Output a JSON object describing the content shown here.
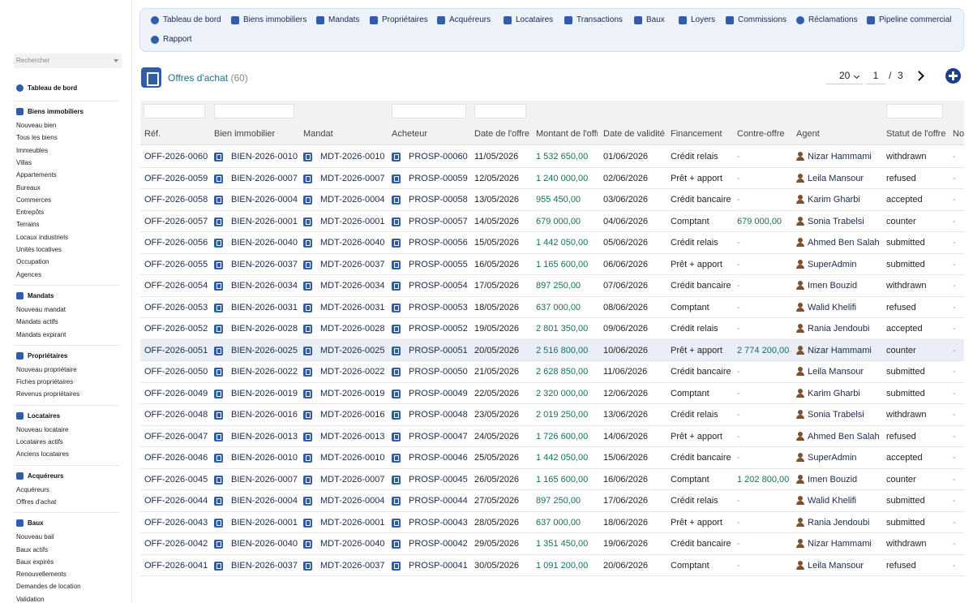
{
  "sidebar": {
    "search_placeholder": "Rechercher",
    "dashboard": "Tableau de bord",
    "sections": [
      {
        "title": "Biens immobiliers",
        "items": [
          "Nouveau bien",
          "Tous les biens",
          "Immeubles",
          "Villas",
          "Appartements",
          "Bureaux",
          "Commerces",
          "Entrepôts",
          "Terrains",
          "Locaux industriels",
          "Unités locatives",
          "Occupation",
          "Agences"
        ]
      },
      {
        "title": "Mandats",
        "items": [
          "Nouveau mandat",
          "Mandats actifs",
          "Mandats expirant"
        ]
      },
      {
        "title": "Propriétaires",
        "items": [
          "Nouveau propriétaire",
          "Fiches propriétaires",
          "Revenus propriétaires"
        ]
      },
      {
        "title": "Locataires",
        "items": [
          "Nouveau locataire",
          "Locataires actifs",
          "Anciens locataires"
        ]
      },
      {
        "title": "Acquéreurs",
        "items": [
          "Acquéreurs",
          "Offres d'achat"
        ]
      },
      {
        "title": "Baux",
        "items": [
          "Nouveau bail",
          "Baux actifs",
          "Baux expirés",
          "Renouvellements",
          "Demandes de location",
          "Validation"
        ]
      }
    ]
  },
  "topnav": [
    "Tableau de bord",
    "Biens immobiliers",
    "Mandats",
    "Propriétaires",
    "Acquéreurs",
    "Locataires",
    "Transactions",
    "Baux",
    "Loyers",
    "Commissions",
    "Réclamations",
    "Pipeline commercial",
    "Rapport"
  ],
  "page": {
    "title": "Offres d'achat",
    "count": "(60)"
  },
  "pager": {
    "page_size": "20",
    "page": "1",
    "slash": "/",
    "total": "3"
  },
  "columns": [
    "Réf.",
    "Bien immobilier",
    "Mandat",
    "Acheteur",
    "Date de l'offre",
    "Montant de l'offre",
    "Date de validité",
    "Financement",
    "Contre-offre",
    "Agent",
    "Statut de l'offre",
    "Notes"
  ],
  "rows": [
    [
      "OFF-2026-0060",
      "BIEN-2026-0010",
      "MDT-2026-0010",
      "PROSP-00060",
      "11/05/2026",
      "1 532 650,00",
      "01/06/2026",
      "Crédit relais",
      "-",
      "Nizar Hammami",
      "withdrawn",
      "-"
    ],
    [
      "OFF-2026-0059",
      "BIEN-2026-0007",
      "MDT-2026-0007",
      "PROSP-00059",
      "12/05/2026",
      "1 240 000,00",
      "02/06/2026",
      "Prêt + apport",
      "-",
      "Leila Mansour",
      "refused",
      "-"
    ],
    [
      "OFF-2026-0058",
      "BIEN-2026-0004",
      "MDT-2026-0004",
      "PROSP-00058",
      "13/05/2026",
      "955 450,00",
      "03/06/2026",
      "Crédit bancaire",
      "-",
      "Karim Gharbi",
      "accepted",
      "-"
    ],
    [
      "OFF-2026-0057",
      "BIEN-2026-0001",
      "MDT-2026-0001",
      "PROSP-00057",
      "14/05/2026",
      "679 000,00",
      "04/06/2026",
      "Comptant",
      "679 000,00",
      "Sonia Trabelsi",
      "counter",
      "-"
    ],
    [
      "OFF-2026-0056",
      "BIEN-2026-0040",
      "MDT-2026-0040",
      "PROSP-00056",
      "15/05/2026",
      "1 442 050,00",
      "05/06/2026",
      "Crédit relais",
      "-",
      "Ahmed Ben Salah",
      "submitted",
      "-"
    ],
    [
      "OFF-2026-0055",
      "BIEN-2026-0037",
      "MDT-2026-0037",
      "PROSP-00055",
      "16/05/2026",
      "1 165 600,00",
      "06/06/2026",
      "Prêt + apport",
      "-",
      "SuperAdmin",
      "submitted",
      "-"
    ],
    [
      "OFF-2026-0054",
      "BIEN-2026-0034",
      "MDT-2026-0034",
      "PROSP-00054",
      "17/05/2026",
      "897 250,00",
      "07/06/2026",
      "Crédit bancaire",
      "-",
      "Imen Bouzid",
      "withdrawn",
      "-"
    ],
    [
      "OFF-2026-0053",
      "BIEN-2026-0031",
      "MDT-2026-0031",
      "PROSP-00053",
      "18/05/2026",
      "637 000,00",
      "08/06/2026",
      "Comptant",
      "-",
      "Walid Khelifi",
      "refused",
      "-"
    ],
    [
      "OFF-2026-0052",
      "BIEN-2026-0028",
      "MDT-2026-0028",
      "PROSP-00052",
      "19/05/2026",
      "2 801 350,00",
      "09/06/2026",
      "Crédit relais",
      "-",
      "Rania Jendoubi",
      "accepted",
      "-"
    ],
    [
      "OFF-2026-0051",
      "BIEN-2026-0025",
      "MDT-2026-0025",
      "PROSP-00051",
      "20/05/2026",
      "2 516 800,00",
      "10/06/2026",
      "Prêt + apport",
      "2 774 200,00",
      "Nizar Hammami",
      "counter",
      "-"
    ],
    [
      "OFF-2026-0050",
      "BIEN-2026-0022",
      "MDT-2026-0022",
      "PROSP-00050",
      "21/05/2026",
      "2 628 850,00",
      "11/06/2026",
      "Crédit bancaire",
      "-",
      "Leila Mansour",
      "submitted",
      "-"
    ],
    [
      "OFF-2026-0049",
      "BIEN-2026-0019",
      "MDT-2026-0019",
      "PROSP-00049",
      "22/05/2026",
      "2 320 000,00",
      "12/06/2026",
      "Comptant",
      "-",
      "Karim Gharbi",
      "submitted",
      "-"
    ],
    [
      "OFF-2026-0048",
      "BIEN-2026-0016",
      "MDT-2026-0016",
      "PROSP-00048",
      "23/05/2026",
      "2 019 250,00",
      "13/06/2026",
      "Crédit relais",
      "-",
      "Sonia Trabelsi",
      "withdrawn",
      "-"
    ],
    [
      "OFF-2026-0047",
      "BIEN-2026-0013",
      "MDT-2026-0013",
      "PROSP-00047",
      "24/05/2026",
      "1 726 600,00",
      "14/06/2026",
      "Prêt + apport",
      "-",
      "Ahmed Ben Salah",
      "refused",
      "-"
    ],
    [
      "OFF-2026-0046",
      "BIEN-2026-0010",
      "MDT-2026-0010",
      "PROSP-00046",
      "25/05/2026",
      "1 442 050,00",
      "15/06/2026",
      "Crédit bancaire",
      "-",
      "SuperAdmin",
      "accepted",
      "-"
    ],
    [
      "OFF-2026-0045",
      "BIEN-2026-0007",
      "MDT-2026-0007",
      "PROSP-00045",
      "26/05/2026",
      "1 165 600,00",
      "16/06/2026",
      "Comptant",
      "1 202 800,00",
      "Imen Bouzid",
      "counter",
      "-"
    ],
    [
      "OFF-2026-0044",
      "BIEN-2026-0004",
      "MDT-2026-0004",
      "PROSP-00044",
      "27/05/2026",
      "897 250,00",
      "17/06/2026",
      "Crédit relais",
      "-",
      "Walid Khelifi",
      "submitted",
      "-"
    ],
    [
      "OFF-2026-0043",
      "BIEN-2026-0001",
      "MDT-2026-0001",
      "PROSP-00043",
      "28/05/2026",
      "637 000,00",
      "18/06/2026",
      "Prêt + apport",
      "-",
      "Rania Jendoubi",
      "submitted",
      "-"
    ],
    [
      "OFF-2026-0042",
      "BIEN-2026-0040",
      "MDT-2026-0040",
      "PROSP-00042",
      "29/05/2026",
      "1 351 450,00",
      "19/06/2026",
      "Crédit bancaire",
      "-",
      "Nizar Hammami",
      "withdrawn",
      "-"
    ],
    [
      "OFF-2026-0041",
      "BIEN-2026-0037",
      "MDT-2026-0037",
      "PROSP-00041",
      "30/05/2026",
      "1 091 200,00",
      "20/06/2026",
      "Comptant",
      "-",
      "Leila Mansour",
      "refused",
      "-"
    ]
  ],
  "highlighted_row": 9,
  "colors": {
    "accent": "#2f5da8",
    "amount": "#16705f",
    "nav_bg": "#eef2fb",
    "agent_icon": "#7a5230"
  },
  "icons": {
    "row_link": "building-icon",
    "agent": "user-icon"
  }
}
